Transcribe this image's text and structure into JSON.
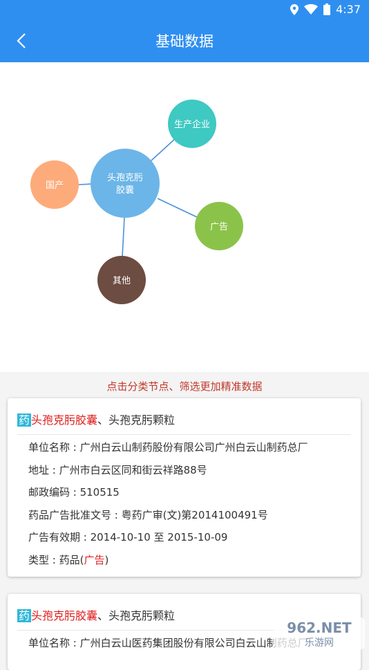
{
  "status": {
    "time": "4:37"
  },
  "header": {
    "title": "基础数据"
  },
  "graph": {
    "center": {
      "line1": "头孢克肟",
      "line2": "胶囊",
      "color": "#6cb5e8"
    },
    "nodes": [
      {
        "label": "生产企业",
        "color": "#3ec9c2"
      },
      {
        "label": "国产",
        "color": "#fdab7a"
      },
      {
        "label": "广告",
        "color": "#8bc34a"
      },
      {
        "label": "其他",
        "color": "#6d4c41"
      }
    ]
  },
  "hint": "点击分类节点、筛选更加精准数据",
  "cards": [
    {
      "tag": "药",
      "highlight": "头孢克肟胶囊",
      "rest": "、头孢克肟颗粒",
      "rows": [
        "单位名称 : 广州白云山制药股份有限公司广州白云山制药总厂",
        "地址 : 广州市白云区同和街云祥路88号",
        "邮政编码 : 510515",
        "药品广告批准文号 : 粤药广审(文)第2014100491号",
        "广告有效期 : 2014-10-10 至 2015-10-09"
      ],
      "type_prefix": "类型 : 药品(",
      "type_value": "广告",
      "type_suffix": ")"
    },
    {
      "tag": "药",
      "highlight": "头孢克肟胶囊",
      "rest": "、头孢克肟颗粒",
      "rows": [
        "单位名称 : 广州白云山医药集团股份有限公司白云山制药总厂"
      ]
    }
  ],
  "watermark": {
    "top": "962.NET",
    "bottom": "乐游网"
  }
}
